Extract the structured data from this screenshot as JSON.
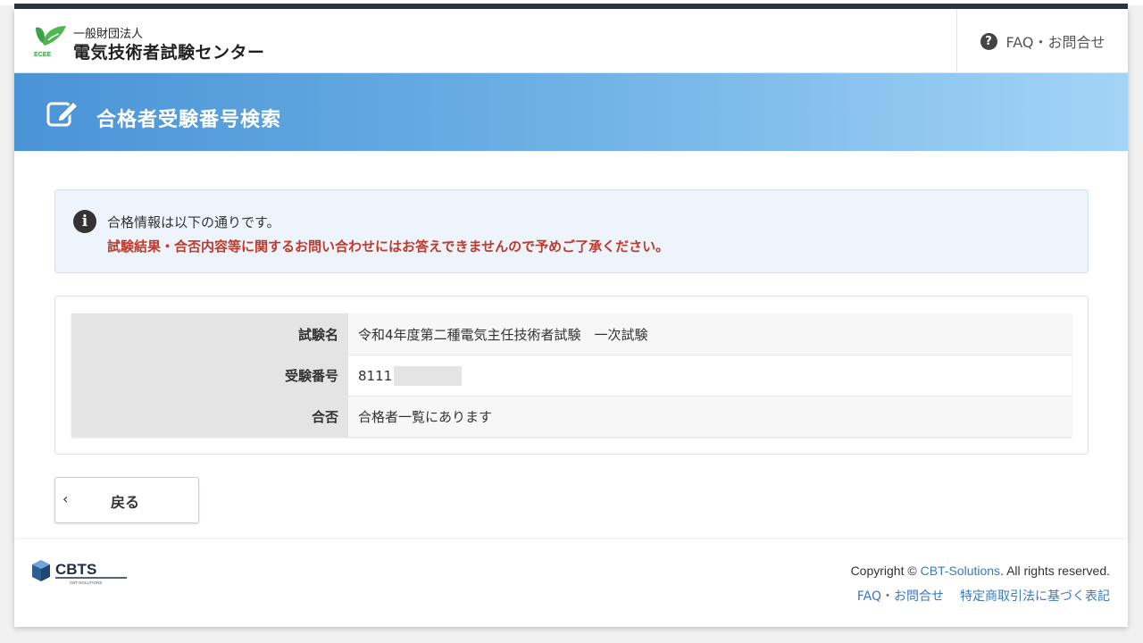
{
  "header": {
    "org_small": "一般財団法人",
    "org_name": "電気技術者試験センター",
    "logo_text": "ECEE",
    "faq_label": "FAQ・お問合せ"
  },
  "banner": {
    "title": "合格者受験番号検索"
  },
  "alert": {
    "line1": "合格情報は以下の通りです。",
    "line2": "試験結果・合否内容等に関するお問い合わせにはお答えできませんので予めご了承ください。"
  },
  "result": {
    "rows": [
      {
        "label": "試験名",
        "value": "令和4年度第二種電気主任技術者試験　一次試験"
      },
      {
        "label": "受験番号",
        "value": "8111"
      },
      {
        "label": "合否",
        "value": "合格者一覧にあります"
      }
    ]
  },
  "back_button": {
    "chevron": "‹",
    "label": "戻る"
  },
  "footer": {
    "logo_text": "CBTS",
    "logo_sub": "CBT-SOLUTIONS",
    "copyright_prefix": "Copyright © ",
    "copyright_link": "CBT-Solutions",
    "copyright_suffix": ". All rights reserved.",
    "links": [
      "FAQ・お問合せ",
      "特定商取引法に基づく表記"
    ]
  },
  "colors": {
    "banner_start": "#4a93d6",
    "banner_end": "#a3d4f6",
    "warning_text": "#c0392b",
    "link": "#3b78c2",
    "logo_green": "#3aa345"
  }
}
